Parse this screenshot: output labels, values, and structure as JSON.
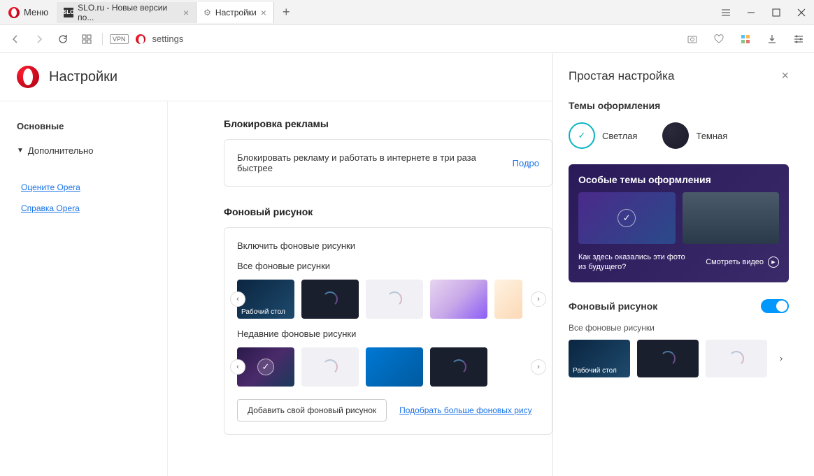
{
  "titlebar": {
    "menu": "Меню",
    "tabs": [
      {
        "label": "SLO.ru - Новые версии по...",
        "favicon_text": "SLO"
      },
      {
        "label": "Настройки"
      }
    ]
  },
  "toolbar": {
    "vpn": "VPN",
    "address": "settings"
  },
  "settings": {
    "title": "Настройки",
    "sidebar": {
      "basic": "Основные",
      "advanced": "Дополнительно",
      "rate": "Оцените Opera",
      "help": "Справка Opera"
    },
    "adblock": {
      "title": "Блокировка рекламы",
      "text": "Блокировать рекламу и работать в интернете в три раза быстрее",
      "link": "Подро"
    },
    "wallpaper": {
      "title": "Фоновый рисунок",
      "enable": "Включить фоновые рисунки",
      "all": "Все фоновые рисунки",
      "desktop_label": "Рабочий стол",
      "recent": "Недавние фоновые рисунки",
      "add_btn": "Добавить свой фоновый рисунок",
      "more_link": "Подобрать больше фоновых рису"
    }
  },
  "panel": {
    "title": "Простая настройка",
    "themes": {
      "title": "Темы оформления",
      "light": "Светлая",
      "dark": "Темная"
    },
    "promo": {
      "title": "Особые темы оформления",
      "question": "Как здесь оказались эти фото из будущего?",
      "video": "Смотреть видео"
    },
    "bg": {
      "title": "Фоновый рисунок",
      "all": "Все фоновые рисунки",
      "desktop_label": "Рабочий стол"
    }
  }
}
